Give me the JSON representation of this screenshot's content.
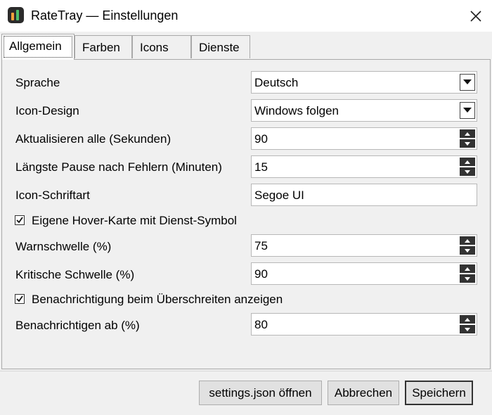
{
  "window": {
    "title": "RateTray — Einstellungen",
    "close_glyph": "✕"
  },
  "tabs": [
    {
      "label": "Allgemein",
      "active": true
    },
    {
      "label": "Farben",
      "active": false
    },
    {
      "label": "Icons",
      "active": false
    },
    {
      "label": "Dienste",
      "active": false
    }
  ],
  "settings": {
    "language": {
      "label": "Sprache",
      "value": "Deutsch"
    },
    "icon_design": {
      "label": "Icon-Design",
      "value": "Windows folgen"
    },
    "refresh": {
      "label": "Aktualisieren alle (Sekunden)",
      "value": "90"
    },
    "max_pause": {
      "label": "Längste Pause nach Fehlern (Minuten)",
      "value": "15"
    },
    "icon_font": {
      "label": "Icon-Schriftart",
      "value": "Segoe UI"
    },
    "hover_card": {
      "label": "Eigene Hover-Karte mit Dienst-Symbol",
      "checked": true
    },
    "warn_threshold": {
      "label": "Warnschwelle (%)",
      "value": "75"
    },
    "critical_threshold": {
      "label": "Kritische Schwelle (%)",
      "value": "90"
    },
    "notify_exceed": {
      "label": "Benachrichtigung beim Überschreiten anzeigen",
      "checked": true
    },
    "notify_from": {
      "label": "Benachrichtigen ab (%)",
      "value": "80"
    }
  },
  "footer": {
    "open_json": "settings.json öffnen",
    "cancel": "Abbrechen",
    "save": "Speichern"
  },
  "icons": {
    "app": "ratetray-app-icon",
    "close": "close-icon",
    "dropdown": "chevron-down-icon",
    "spin_up": "spin-up-icon",
    "spin_down": "spin-down-icon",
    "check": "checkmark-icon"
  }
}
